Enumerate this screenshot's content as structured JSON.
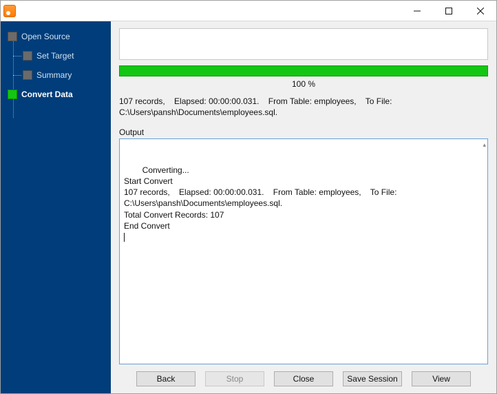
{
  "window": {
    "title": ""
  },
  "sidebar": {
    "items": [
      {
        "label": "Open Source",
        "active": false
      },
      {
        "label": "Set Target",
        "active": false
      },
      {
        "label": "Summary",
        "active": false
      },
      {
        "label": "Convert Data",
        "active": true
      }
    ]
  },
  "progress": {
    "percent_label": "100 %"
  },
  "status": {
    "line": "107 records,    Elapsed: 00:00:00.031.    From Table: employees,    To File: C:\\Users\\pansh\\Documents\\employees.sql."
  },
  "output": {
    "label": "Output",
    "lines": "Converting...\nStart Convert\n107 records,    Elapsed: 00:00:00.031.    From Table: employees,    To File: C:\\Users\\pansh\\Documents\\employees.sql.\nTotal Convert Records: 107\nEnd Convert"
  },
  "buttons": {
    "back": "Back",
    "stop": "Stop",
    "close": "Close",
    "save_session": "Save Session",
    "view": "View"
  }
}
